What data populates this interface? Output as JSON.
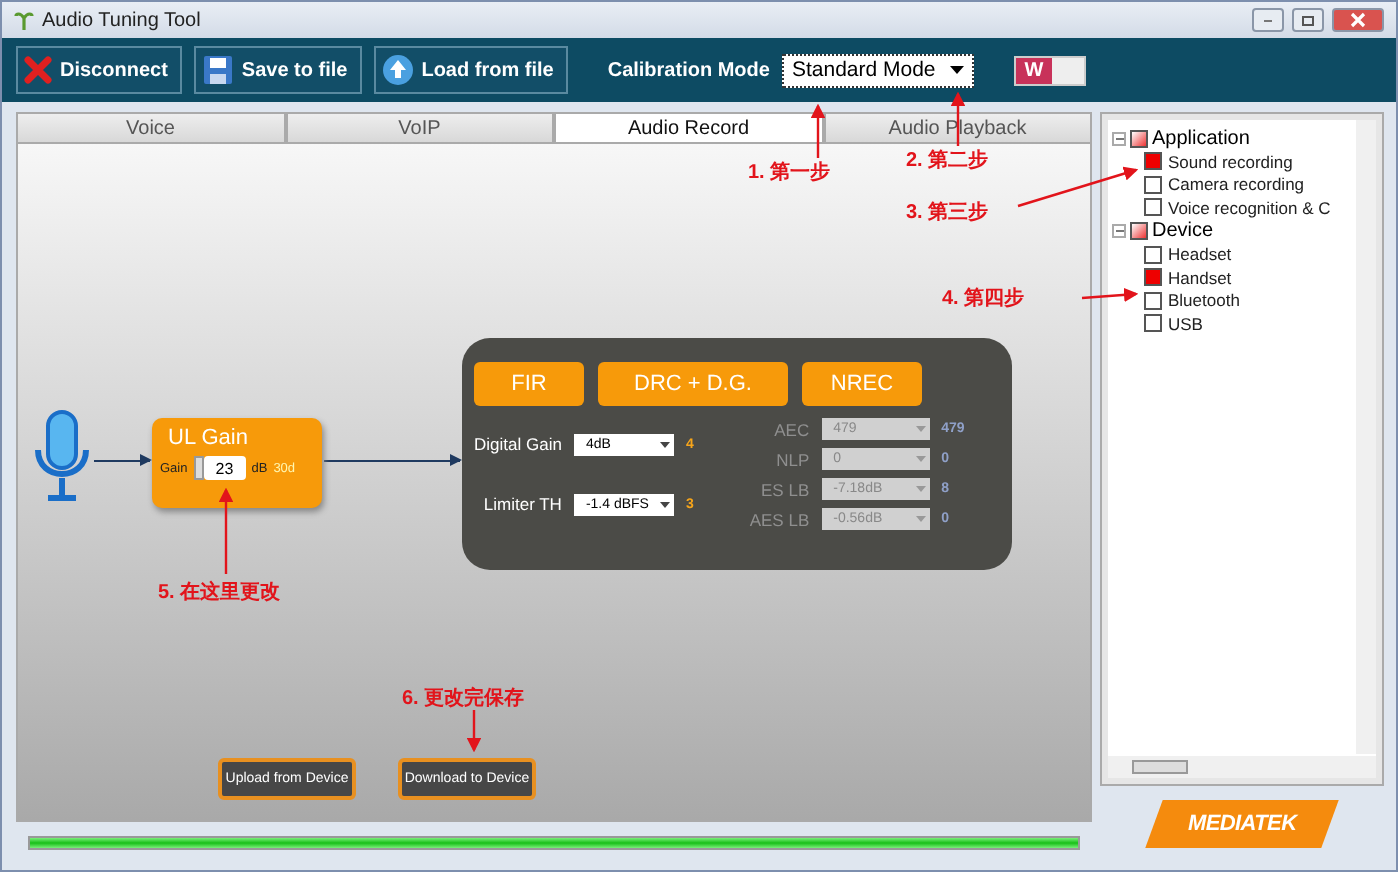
{
  "window": {
    "title": "Audio Tuning Tool"
  },
  "toolbar": {
    "buttons": [
      {
        "kind": "disconnect",
        "label": "Disconnect"
      },
      {
        "kind": "save",
        "label": "Save to file"
      },
      {
        "kind": "load",
        "label": "Load from file"
      }
    ],
    "calibration_label": "Calibration Mode",
    "calibration_value": "Standard Mode",
    "switch_label": "W",
    "switch_on": true
  },
  "tabs": [
    {
      "label": "Voice",
      "selected": false
    },
    {
      "label": "VoIP",
      "selected": false
    },
    {
      "label": "Audio Record",
      "selected": true
    },
    {
      "label": "Audio Playback",
      "selected": false
    }
  ],
  "ul_gain": {
    "title": "UL Gain",
    "label": "Gain",
    "value": "23",
    "unit": "dB",
    "reading": "30d"
  },
  "blocks": [
    "FIR",
    "DRC + D.G.",
    "NREC"
  ],
  "left_params": [
    {
      "label": "Digital Gain",
      "value": "4dB",
      "reading": "4"
    },
    {
      "label": "Limiter TH",
      "value": "-1.4 dBFS",
      "reading": "3"
    }
  ],
  "right_params": [
    {
      "label": "AEC",
      "value": "479",
      "reading": "479",
      "disabled": true
    },
    {
      "label": "NLP",
      "value": "0",
      "reading": "0",
      "disabled": true
    },
    {
      "label": "ES LB",
      "value": "-7.18dB",
      "reading": "8",
      "disabled": true
    },
    {
      "label": "AES LB",
      "value": "-0.56dB",
      "reading": "0",
      "disabled": true
    }
  ],
  "actions": [
    "Upload from Device",
    "Download to Device"
  ],
  "progress": {
    "level": 1.0
  },
  "tree": [
    {
      "label": "Application",
      "expanded": true,
      "mixed": true,
      "children": [
        {
          "label": "Sound recording",
          "checked": true
        },
        {
          "label": "Camera recording",
          "checked": false
        },
        {
          "label": "Voice recognition & C",
          "checked": false
        }
      ]
    },
    {
      "label": "Device",
      "expanded": true,
      "mixed": true,
      "children": [
        {
          "label": "Headset",
          "checked": false
        },
        {
          "label": "Handset",
          "checked": true
        },
        {
          "label": "Bluetooth",
          "checked": false
        },
        {
          "label": "USB",
          "checked": false
        }
      ]
    }
  ],
  "logo": "MEDIATEK",
  "annotations": [
    "1. 第一步",
    "2. 第二步",
    "3. 第三步",
    "4. 第四步",
    "5. 在这里更改",
    "6. 更改完保存"
  ]
}
